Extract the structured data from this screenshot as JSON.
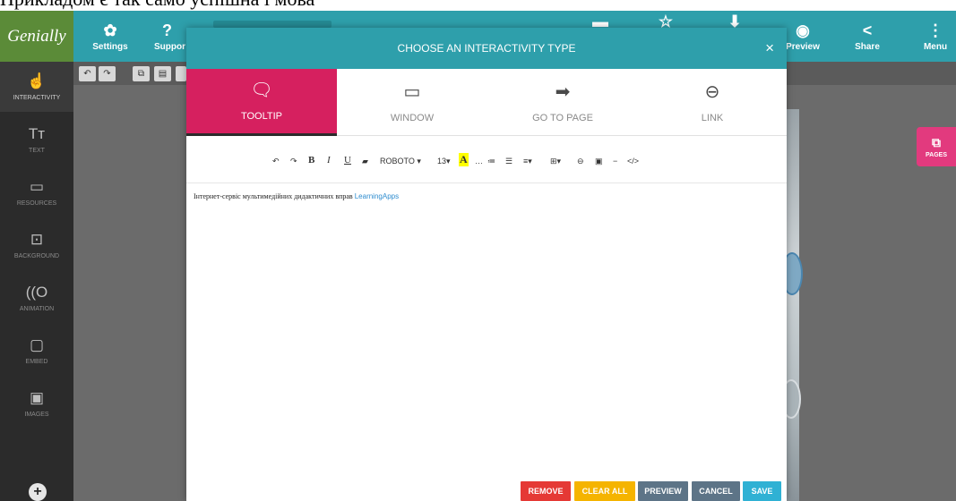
{
  "top_strip": {
    "text": "Прикладом є так само успішна і мова"
  },
  "header": {
    "logo": "Genially",
    "settings": {
      "label": "Settings",
      "icon": "gear-icon"
    },
    "support": {
      "label": "Suppor",
      "icon": "help-circle-icon"
    },
    "preview": {
      "label": "Preview",
      "icon": "eye-icon"
    },
    "share": {
      "label": "Share",
      "icon": "share-icon"
    },
    "menu": {
      "label": "Menu",
      "icon": "kebab-menu-icon"
    }
  },
  "sidebar": {
    "items": [
      {
        "label": "INTERACTIVITY",
        "icon": "hand-pointer-icon"
      },
      {
        "label": "TEXT",
        "icon": "text-icon"
      },
      {
        "label": "RESOURCES",
        "icon": "resources-icon"
      },
      {
        "label": "BACKGROUND",
        "icon": "background-icon"
      },
      {
        "label": "ANIMATION",
        "icon": "animation-icon"
      },
      {
        "label": "EMBED",
        "icon": "embed-icon"
      },
      {
        "label": "IMAGES",
        "icon": "image-icon"
      }
    ],
    "add": "+"
  },
  "pages": {
    "label": "PAGES",
    "icon": "pages-icon"
  },
  "modal": {
    "title": "CHOOSE AN INTERACTIVITY TYPE",
    "close": "×",
    "tabs": [
      {
        "label": "TOOLTIP",
        "icon": "tooltip-icon"
      },
      {
        "label": "WINDOW",
        "icon": "window-icon"
      },
      {
        "label": "GO TO PAGE",
        "icon": "arrow-right-icon"
      },
      {
        "label": "LINK",
        "icon": "link-icon"
      }
    ],
    "toolbar": {
      "font": "ROBOTO ▾",
      "size": "13▾",
      "color": "A",
      "bold": "B",
      "italic": "I",
      "underline": "U"
    },
    "content": {
      "text": "Інтернет-сервіс мультимедійних дидактичних вправ ",
      "link": "LearningApps"
    },
    "buttons": {
      "remove": "REMOVE",
      "clear_all": "CLEAR ALL",
      "preview": "PREVIEW",
      "cancel": "CANCEL",
      "save": "SAVE"
    }
  },
  "colors": {
    "header": "#2e9fab",
    "logo": "#5b8b38",
    "active_tab": "#d6205f",
    "remove": "#e53935",
    "clear_all": "#f5b400",
    "preview": "#5d7487",
    "cancel": "#5d7487",
    "save": "#2fb1d4",
    "pages": "#e23a7e"
  }
}
